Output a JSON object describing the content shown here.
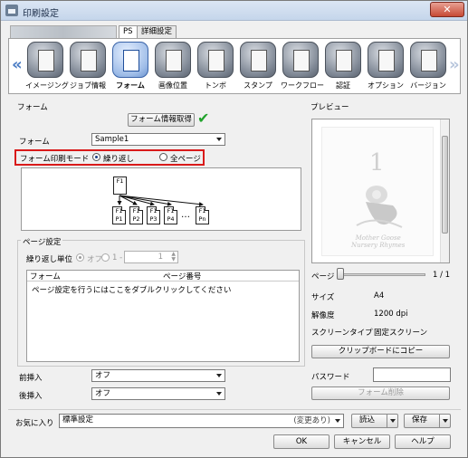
{
  "window": {
    "title": "印刷設定",
    "close_label": "✕"
  },
  "tabs": [
    {
      "label": "PS"
    },
    {
      "label": "詳細設定"
    }
  ],
  "toolbar": {
    "prev_arrow": "«",
    "next_arrow": "»",
    "items": [
      {
        "label": "イメージング"
      },
      {
        "label": "ジョブ情報"
      },
      {
        "label": "フォーム"
      },
      {
        "label": "画像位置"
      },
      {
        "label": "トンボ"
      },
      {
        "label": "スタンプ"
      },
      {
        "label": "ワークフロー"
      },
      {
        "label": "認証"
      },
      {
        "label": "オプション"
      },
      {
        "label": "バージョン"
      }
    ]
  },
  "form_section": {
    "group_title": "フォーム",
    "info_button": "フォーム情報取得",
    "form_label": "フォーム",
    "form_value": "Sample1",
    "mode_label": "フォーム印刷モード",
    "mode_options": [
      "繰り返し",
      "全ページ"
    ],
    "diagram": {
      "top": "F1",
      "pages": [
        "P1",
        "P2",
        "P3",
        "P4",
        "Pn"
      ],
      "fold": "F1",
      "dots": "…"
    }
  },
  "page_settings": {
    "group_title": "ページ設定",
    "repeat_label": "繰り返し単位",
    "off_label": "オフ",
    "range_label": "1 -",
    "spin_value": "1",
    "columns": [
      "フォーム",
      "ページ番号"
    ],
    "hint": "ページ設定を行うにはここをダブルクリックしてください"
  },
  "insert": {
    "front_label": "前挿入",
    "front_value": "オフ",
    "back_label": "後挿入",
    "back_value": "オフ"
  },
  "preview": {
    "group_title": "プレビュー",
    "page_number": "1",
    "book_title_line1": "Mother Goose",
    "book_title_line2": "Nursery Rhymes",
    "page_label": "ページ",
    "page_counter": "1 / 1",
    "rows": [
      {
        "label": "サイズ",
        "value": "A4"
      },
      {
        "label": "解像度",
        "value": "1200 dpi"
      },
      {
        "label": "スクリーンタイプ",
        "value": "固定スクリーン"
      }
    ],
    "copy_button": "クリップボードにコピー",
    "password_label": "パスワード",
    "delete_button": "フォーム削除"
  },
  "favorites": {
    "label": "お気に入り",
    "value": "標準設定",
    "changed": "(変更あり)",
    "load_button": "読込",
    "save_button": "保存"
  },
  "footer": {
    "ok": "OK",
    "cancel": "キャンセル",
    "help": "ヘルプ"
  }
}
